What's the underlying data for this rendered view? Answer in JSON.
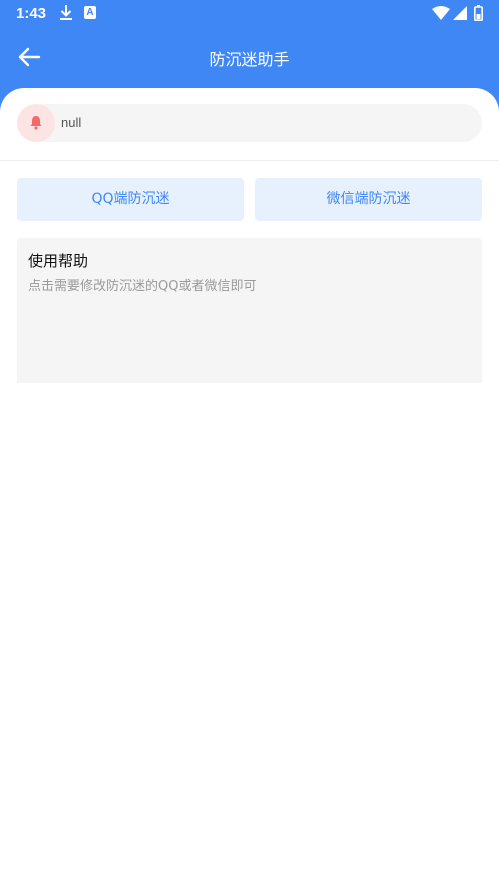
{
  "status_bar": {
    "time": "1:43",
    "a_icon_label": "A"
  },
  "header": {
    "title": "防沉迷助手"
  },
  "notice": {
    "text": "null"
  },
  "buttons": {
    "qq_label": "QQ端防沉迷",
    "wechat_label": "微信端防沉迷"
  },
  "help": {
    "title": "使用帮助",
    "description": "点击需要修改防沉迷的QQ或者微信即可"
  },
  "colors": {
    "primary": "#3f87f5",
    "button_bg": "#e6f1fd",
    "bell": "#f26b6b",
    "bell_bg": "#fde4e4",
    "card_bg": "#f5f5f5"
  }
}
